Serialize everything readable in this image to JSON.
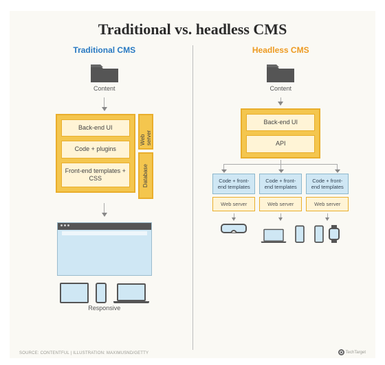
{
  "title": "Traditional vs. headless CMS",
  "traditional": {
    "heading": "Traditional CMS",
    "content_label": "Content",
    "layers": {
      "backend_ui": "Back-end UI",
      "code_plugins": "Code + plugins",
      "frontend_templates": "Front-end templates + CSS"
    },
    "sides": {
      "web_server": "Web server",
      "database": "Database"
    },
    "responsive_label": "Responsive"
  },
  "headless": {
    "heading": "Headless CMS",
    "content_label": "Content",
    "layers": {
      "backend_ui": "Back-end UI",
      "api": "API"
    },
    "consumer": {
      "code_templates": "Code + front-end templates",
      "web_server": "Web server"
    }
  },
  "footer_left": "SOURCE: CONTENTFUL | ILLUSTRATION: MAXIMUSND/GETTY",
  "footer_right": "TechTarget"
}
